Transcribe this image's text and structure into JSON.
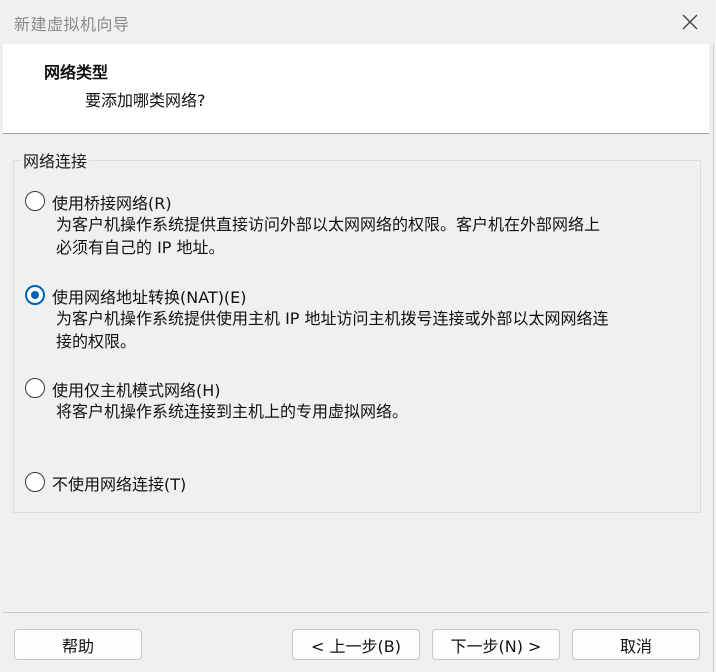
{
  "window": {
    "title": "新建虚拟机向导",
    "close_glyph": "✕"
  },
  "header": {
    "title": "网络类型",
    "subtitle": "要添加哪类网络?"
  },
  "group": {
    "legend": "网络连接"
  },
  "options": [
    {
      "label": "使用桥接网络(R)",
      "desc_line1": "为客户机操作系统提供直接访问外部以太网网络的权限。客户机在外部网络上",
      "desc_line2": "必须有自己的 IP 地址。",
      "selected": false
    },
    {
      "label": "使用网络地址转换(NAT)(E)",
      "desc_line1": "为客户机操作系统提供使用主机 IP 地址访问主机拨号连接或外部以太网网络连",
      "desc_line2": "接的权限。",
      "selected": true
    },
    {
      "label": "使用仅主机模式网络(H)",
      "desc_line1": "将客户机操作系统连接到主机上的专用虚拟网络。",
      "desc_line2": "",
      "selected": false
    },
    {
      "label": "不使用网络连接(T)",
      "desc_line1": "",
      "desc_line2": "",
      "selected": false
    }
  ],
  "buttons": {
    "help": "帮助",
    "back": "< 上一步(B)",
    "next": "下一步(N) >",
    "cancel": "取消"
  },
  "colors": {
    "accent": "#0063b1",
    "dialog_bg": "#f0f0f0",
    "header_bg": "#ffffff"
  },
  "icons": {
    "close": "close-icon",
    "radio": "radio-button"
  }
}
